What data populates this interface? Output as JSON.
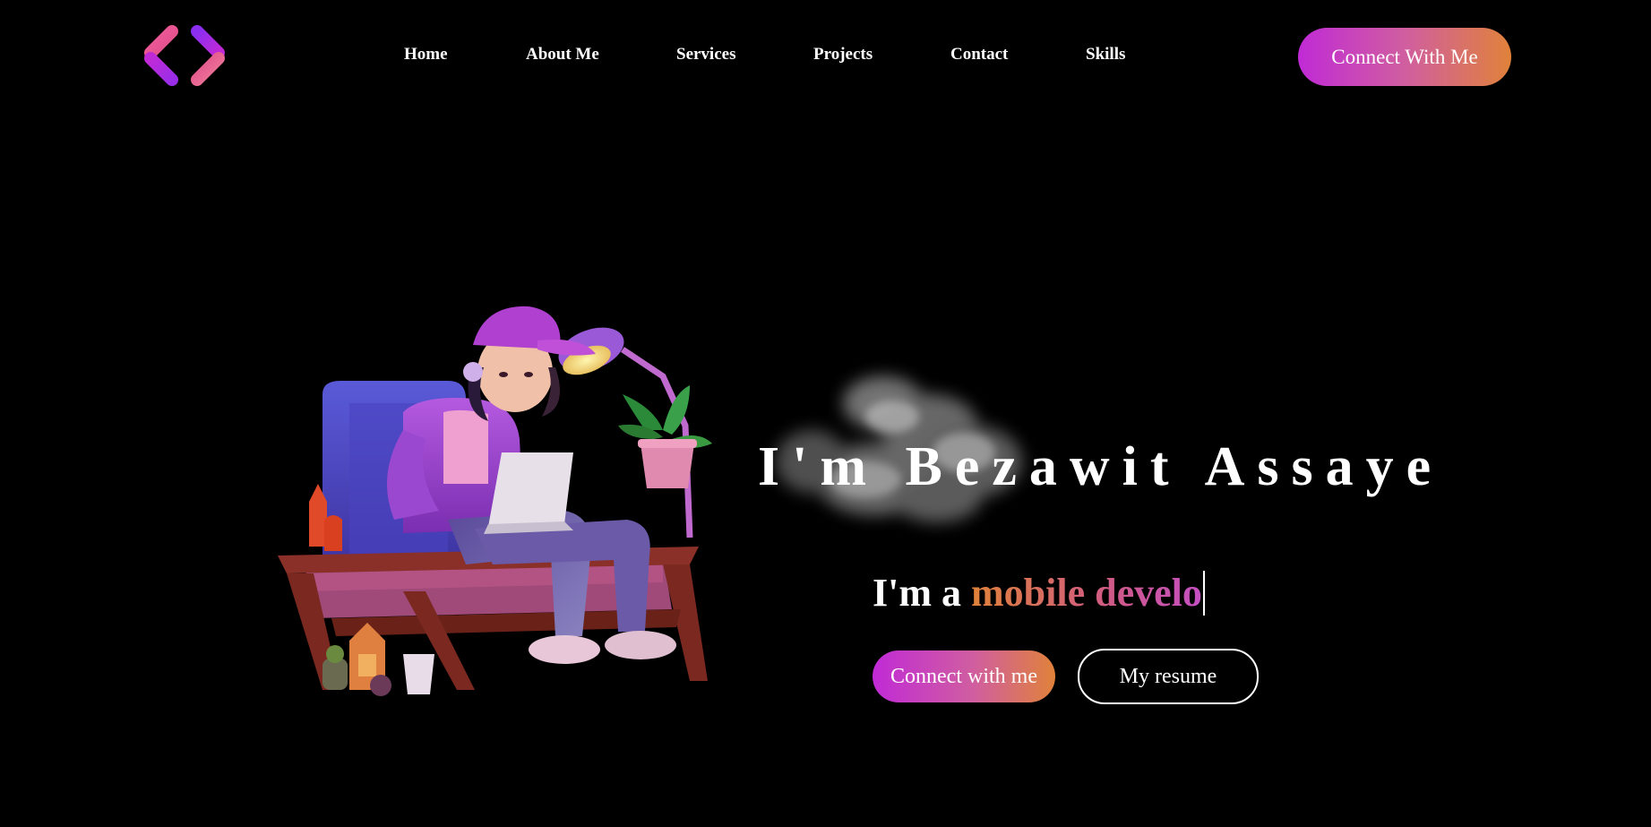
{
  "header": {
    "logo_icon": "code-brackets-icon",
    "nav": [
      {
        "label": "Home"
      },
      {
        "label": "About Me"
      },
      {
        "label": "Services"
      },
      {
        "label": "Projects"
      },
      {
        "label": "Contact"
      },
      {
        "label": "Skills"
      }
    ],
    "cta_label": "Connect With Me"
  },
  "hero": {
    "illustration": "girl-with-laptop-illustration",
    "smoke": "smoke-decoration",
    "name": "I'm Bezawit Assaye",
    "role_prefix": "I'm a",
    "role_typed": "mobile develo",
    "connect_label": "Connect with me",
    "resume_label": "My resume"
  },
  "colors": {
    "background": "#000000",
    "gradient_start": "#c02ad6",
    "gradient_end": "#e0823a",
    "text": "#ffffff"
  }
}
